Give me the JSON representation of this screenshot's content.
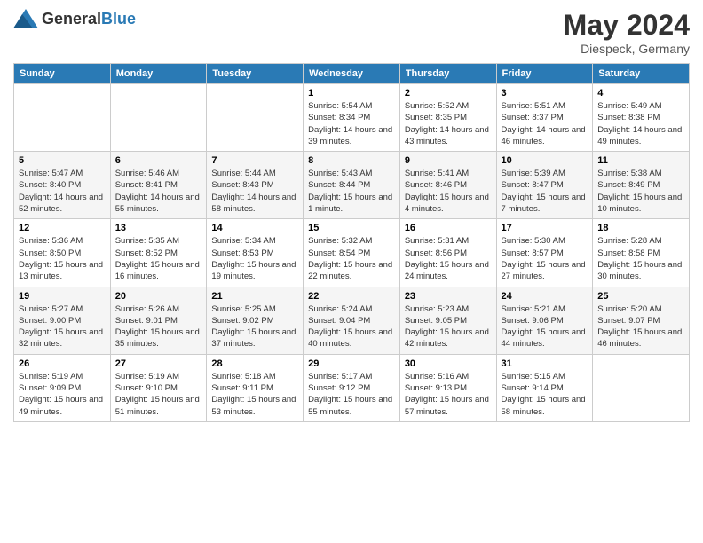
{
  "logo": {
    "general": "General",
    "blue": "Blue"
  },
  "header": {
    "month_year": "May 2024",
    "location": "Diespeck, Germany"
  },
  "weekdays": [
    "Sunday",
    "Monday",
    "Tuesday",
    "Wednesday",
    "Thursday",
    "Friday",
    "Saturday"
  ],
  "weeks": [
    [
      {
        "day": "",
        "info": ""
      },
      {
        "day": "",
        "info": ""
      },
      {
        "day": "",
        "info": ""
      },
      {
        "day": "1",
        "info": "Sunrise: 5:54 AM\nSunset: 8:34 PM\nDaylight: 14 hours and 39 minutes."
      },
      {
        "day": "2",
        "info": "Sunrise: 5:52 AM\nSunset: 8:35 PM\nDaylight: 14 hours and 43 minutes."
      },
      {
        "day": "3",
        "info": "Sunrise: 5:51 AM\nSunset: 8:37 PM\nDaylight: 14 hours and 46 minutes."
      },
      {
        "day": "4",
        "info": "Sunrise: 5:49 AM\nSunset: 8:38 PM\nDaylight: 14 hours and 49 minutes."
      }
    ],
    [
      {
        "day": "5",
        "info": "Sunrise: 5:47 AM\nSunset: 8:40 PM\nDaylight: 14 hours and 52 minutes."
      },
      {
        "day": "6",
        "info": "Sunrise: 5:46 AM\nSunset: 8:41 PM\nDaylight: 14 hours and 55 minutes."
      },
      {
        "day": "7",
        "info": "Sunrise: 5:44 AM\nSunset: 8:43 PM\nDaylight: 14 hours and 58 minutes."
      },
      {
        "day": "8",
        "info": "Sunrise: 5:43 AM\nSunset: 8:44 PM\nDaylight: 15 hours and 1 minute."
      },
      {
        "day": "9",
        "info": "Sunrise: 5:41 AM\nSunset: 8:46 PM\nDaylight: 15 hours and 4 minutes."
      },
      {
        "day": "10",
        "info": "Sunrise: 5:39 AM\nSunset: 8:47 PM\nDaylight: 15 hours and 7 minutes."
      },
      {
        "day": "11",
        "info": "Sunrise: 5:38 AM\nSunset: 8:49 PM\nDaylight: 15 hours and 10 minutes."
      }
    ],
    [
      {
        "day": "12",
        "info": "Sunrise: 5:36 AM\nSunset: 8:50 PM\nDaylight: 15 hours and 13 minutes."
      },
      {
        "day": "13",
        "info": "Sunrise: 5:35 AM\nSunset: 8:52 PM\nDaylight: 15 hours and 16 minutes."
      },
      {
        "day": "14",
        "info": "Sunrise: 5:34 AM\nSunset: 8:53 PM\nDaylight: 15 hours and 19 minutes."
      },
      {
        "day": "15",
        "info": "Sunrise: 5:32 AM\nSunset: 8:54 PM\nDaylight: 15 hours and 22 minutes."
      },
      {
        "day": "16",
        "info": "Sunrise: 5:31 AM\nSunset: 8:56 PM\nDaylight: 15 hours and 24 minutes."
      },
      {
        "day": "17",
        "info": "Sunrise: 5:30 AM\nSunset: 8:57 PM\nDaylight: 15 hours and 27 minutes."
      },
      {
        "day": "18",
        "info": "Sunrise: 5:28 AM\nSunset: 8:58 PM\nDaylight: 15 hours and 30 minutes."
      }
    ],
    [
      {
        "day": "19",
        "info": "Sunrise: 5:27 AM\nSunset: 9:00 PM\nDaylight: 15 hours and 32 minutes."
      },
      {
        "day": "20",
        "info": "Sunrise: 5:26 AM\nSunset: 9:01 PM\nDaylight: 15 hours and 35 minutes."
      },
      {
        "day": "21",
        "info": "Sunrise: 5:25 AM\nSunset: 9:02 PM\nDaylight: 15 hours and 37 minutes."
      },
      {
        "day": "22",
        "info": "Sunrise: 5:24 AM\nSunset: 9:04 PM\nDaylight: 15 hours and 40 minutes."
      },
      {
        "day": "23",
        "info": "Sunrise: 5:23 AM\nSunset: 9:05 PM\nDaylight: 15 hours and 42 minutes."
      },
      {
        "day": "24",
        "info": "Sunrise: 5:21 AM\nSunset: 9:06 PM\nDaylight: 15 hours and 44 minutes."
      },
      {
        "day": "25",
        "info": "Sunrise: 5:20 AM\nSunset: 9:07 PM\nDaylight: 15 hours and 46 minutes."
      }
    ],
    [
      {
        "day": "26",
        "info": "Sunrise: 5:19 AM\nSunset: 9:09 PM\nDaylight: 15 hours and 49 minutes."
      },
      {
        "day": "27",
        "info": "Sunrise: 5:19 AM\nSunset: 9:10 PM\nDaylight: 15 hours and 51 minutes."
      },
      {
        "day": "28",
        "info": "Sunrise: 5:18 AM\nSunset: 9:11 PM\nDaylight: 15 hours and 53 minutes."
      },
      {
        "day": "29",
        "info": "Sunrise: 5:17 AM\nSunset: 9:12 PM\nDaylight: 15 hours and 55 minutes."
      },
      {
        "day": "30",
        "info": "Sunrise: 5:16 AM\nSunset: 9:13 PM\nDaylight: 15 hours and 57 minutes."
      },
      {
        "day": "31",
        "info": "Sunrise: 5:15 AM\nSunset: 9:14 PM\nDaylight: 15 hours and 58 minutes."
      },
      {
        "day": "",
        "info": ""
      }
    ]
  ]
}
